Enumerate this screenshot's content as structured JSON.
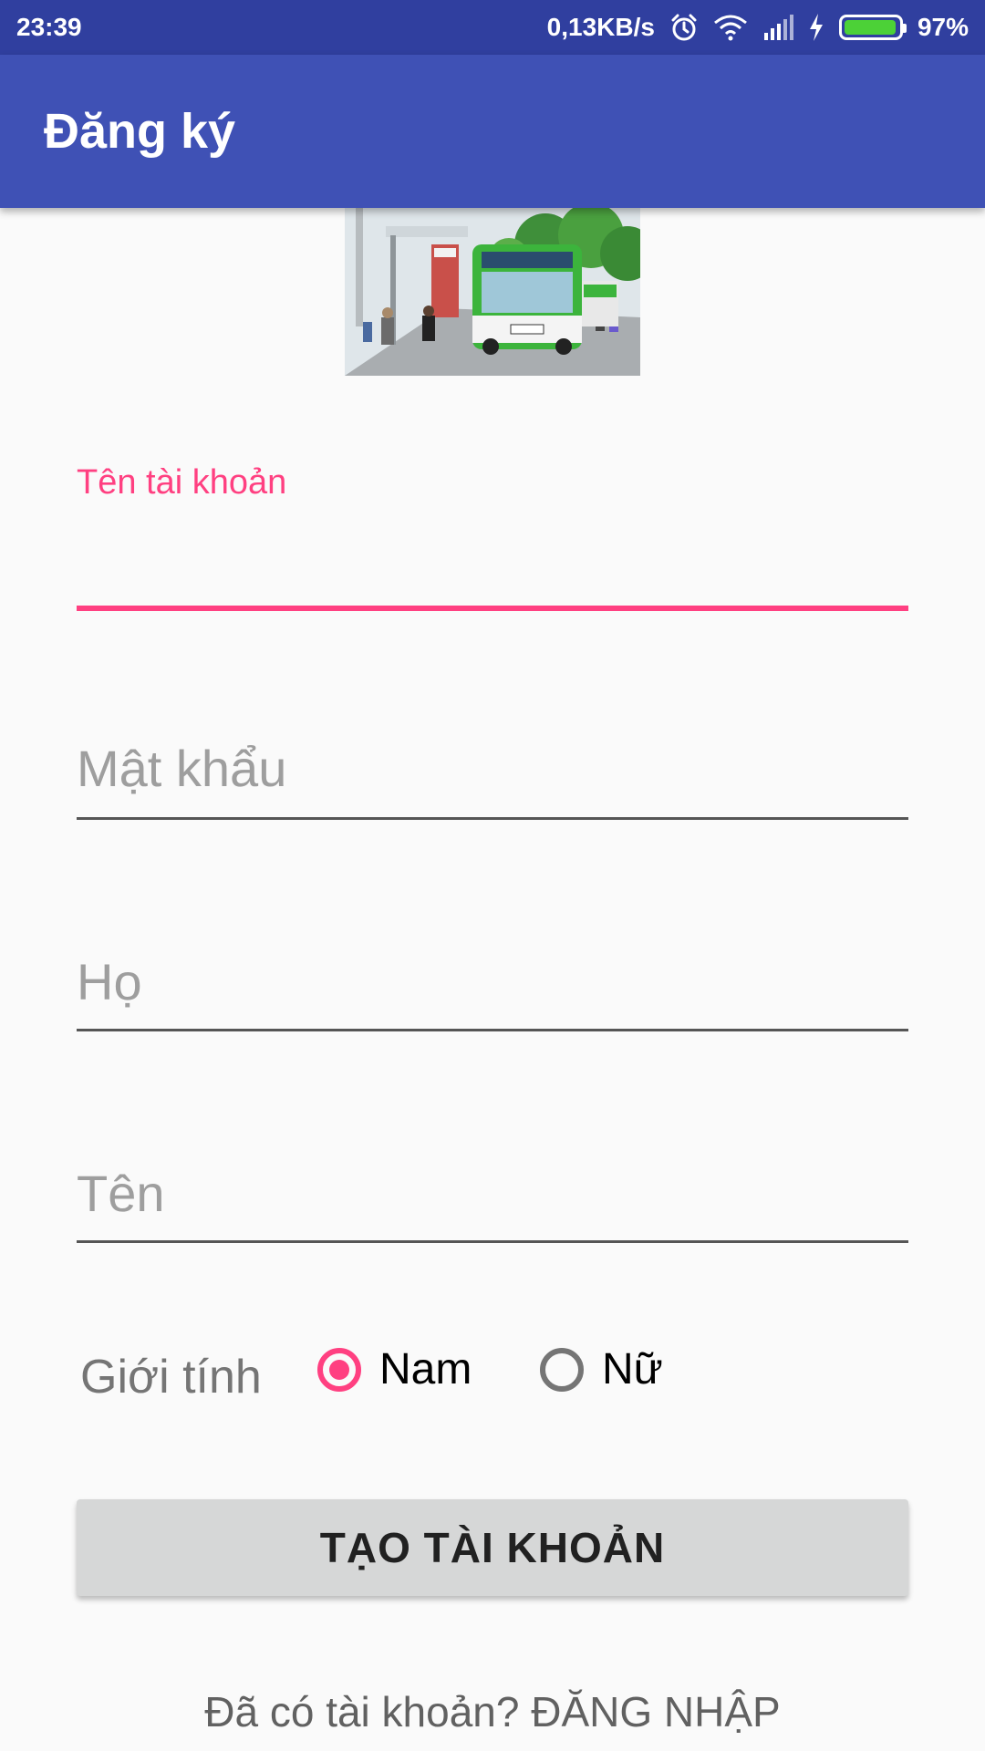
{
  "status_bar": {
    "time": "23:39",
    "net_speed": "0,13KB/s",
    "battery_percent": "97%",
    "battery_level": 0.97,
    "icons": [
      "alarm-icon",
      "wifi-icon",
      "signal-icon",
      "charging-icon",
      "battery-icon"
    ]
  },
  "app_bar": {
    "title": "Đăng ký"
  },
  "form": {
    "username": {
      "label": "Tên tài khoản",
      "value": ""
    },
    "password": {
      "hint": "Mật khẩu"
    },
    "last_name": {
      "hint": "Họ"
    },
    "first_name": {
      "hint": "Tên"
    },
    "gender": {
      "label": "Giới tính",
      "options": [
        "Nam",
        "Nữ"
      ],
      "selected": "Nam"
    },
    "submit_label": "TẠO TÀI KHOẢN",
    "login_prompt": "Đã có tài khoản? ĐĂNG NHẬP"
  },
  "colors": {
    "status_bar": "#303f9f",
    "primary": "#3f51b5",
    "accent": "#ff4081",
    "background": "#fafafa",
    "button": "#d6d7d7"
  },
  "image": {
    "icon": "bus-stop-image"
  }
}
